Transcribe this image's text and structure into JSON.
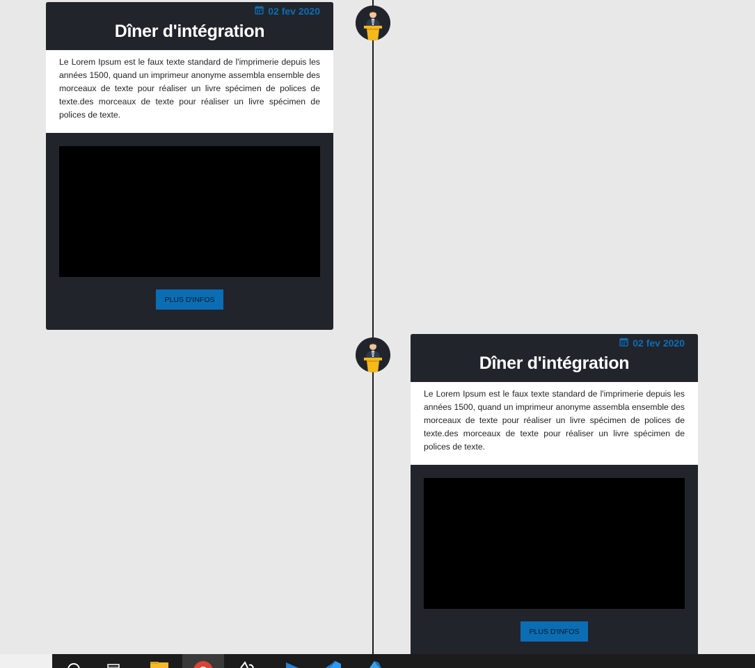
{
  "timeline": {
    "entries": [
      {
        "date": "02 fev 2020",
        "title": "Dîner d'intégration",
        "text": "Le Lorem Ipsum est le faux texte standard de l'imprimerie depuis les années 1500, quand un imprimeur anonyme assembla ensemble des morceaux de texte pour réaliser un livre spécimen de polices de texte.des morceaux de texte pour réaliser un livre spécimen de polices de texte.",
        "button_label": "PLUS D'INFOS",
        "side": "left"
      },
      {
        "date": "02 fev 2020",
        "title": "Dîner d'intégration",
        "text": "Le Lorem Ipsum est le faux texte standard de l'imprimerie depuis les années 1500, quand un imprimeur anonyme assembla ensemble des morceaux de texte pour réaliser un livre spécimen de polices de texte.des morceaux de texte pour réaliser un livre spécimen de polices de texte.",
        "button_label": "PLUS D'INFOS",
        "side": "right"
      }
    ]
  },
  "icons": {
    "date": "calendar-icon",
    "avatar": "speaker-at-podium-icon"
  },
  "taskbar": {
    "apps": [
      "search-icon",
      "task-view-icon",
      "file-explorer-icon",
      "chrome-icon",
      "app-icon",
      "media-player-icon",
      "vscode-icon",
      "azure-icon"
    ]
  },
  "colors": {
    "background": "#e8e8e8",
    "card": "#21242b",
    "accent": "#0b6db3",
    "podium": "#f6b91c"
  }
}
